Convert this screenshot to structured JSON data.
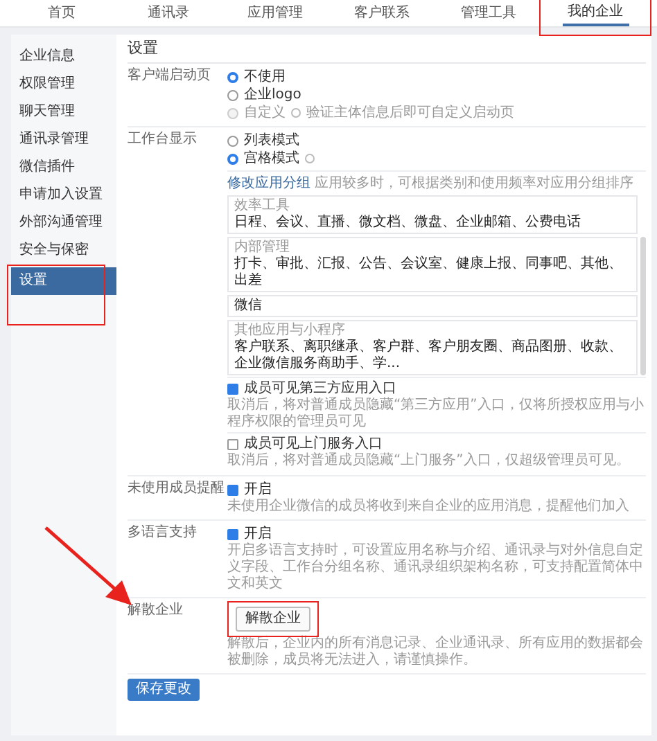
{
  "nav": [
    {
      "label": "首页",
      "selected": false,
      "highlighted": false
    },
    {
      "label": "通讯录",
      "selected": false,
      "highlighted": false
    },
    {
      "label": "应用管理",
      "selected": false,
      "highlighted": false
    },
    {
      "label": "客户联系",
      "selected": false,
      "highlighted": false
    },
    {
      "label": "管理工具",
      "selected": false,
      "highlighted": false
    },
    {
      "label": "我的企业",
      "selected": true,
      "highlighted": true
    }
  ],
  "sidebar": {
    "items": [
      {
        "label": "企业信息",
        "selected": false,
        "highlighted": false
      },
      {
        "label": "权限管理",
        "selected": false,
        "highlighted": false
      },
      {
        "label": "聊天管理",
        "selected": false,
        "highlighted": false
      },
      {
        "label": "通讯录管理",
        "selected": false,
        "highlighted": false
      },
      {
        "label": "微信插件",
        "selected": false,
        "highlighted": false
      },
      {
        "label": "申请加入设置",
        "selected": false,
        "highlighted": false
      },
      {
        "label": "外部沟通管理",
        "selected": false,
        "highlighted": false
      },
      {
        "label": "安全与保密",
        "selected": false,
        "highlighted": false
      },
      {
        "label": "设置",
        "selected": true,
        "highlighted": true
      }
    ]
  },
  "page_title": "设置",
  "sections": [
    {
      "kind": "radios",
      "label": "客户端启动页",
      "options": [
        {
          "label": "不使用",
          "selected": true,
          "disabled": false
        },
        {
          "label": "企业logo",
          "selected": false,
          "disabled": false
        },
        {
          "label": "自定义",
          "selected": false,
          "disabled": true,
          "hint": "验证主体信息后即可自定义启动页"
        }
      ]
    },
    {
      "kind": "workbench",
      "label": "工作台显示",
      "options": [
        {
          "label": "列表模式",
          "selected": false,
          "disabled": false,
          "info": false
        },
        {
          "label": "宫格模式",
          "selected": true,
          "disabled": false,
          "info": true
        }
      ],
      "group_link": "修改应用分组",
      "group_hint": "应用较多时，可根据类别和使用频率对应用分组排序",
      "groups": [
        {
          "title": "效率工具",
          "apps": "日程、会议、直播、微文档、微盘、企业邮箱、公费电话"
        },
        {
          "title": "内部管理",
          "apps": "打卡、审批、汇报、公告、会议室、健康上报、同事吧、其他、出差"
        },
        {
          "apps": "微信"
        },
        {
          "title": "其他应用与小程序",
          "apps": "客户联系、离职继承、客户群、客户朋友圈、商品图册、收款、企业微信服务商助手、学..."
        }
      ],
      "toggles": [
        {
          "label": "成员可见第三方应用入口",
          "checked": true,
          "description": "取消后，将对普通成员隐藏“第三方应用”入口，仅将所授权应用与小程序权限的管理员可见"
        },
        {
          "label": "成员可见上门服务入口",
          "checked": false,
          "description": "取消后，将对普通成员隐藏“上门服务”入口，仅超级管理员可见。"
        }
      ]
    },
    {
      "kind": "checkbox",
      "label": "未使用成员提醒",
      "checkbox": {
        "label": "开启",
        "checked": true
      },
      "description": "未使用企业微信的成员将收到来自企业的应用消息，提醒他们加入"
    },
    {
      "kind": "checkbox",
      "label": "多语言支持",
      "checkbox": {
        "label": "开启",
        "checked": true
      },
      "description": "开启多语言支持时，可设置应用名称与介绍、通讯录与对外信息自定义字段、工作台分组名称、通讯录组织架构名称，可支持配置简体中文和英文"
    },
    {
      "kind": "action",
      "label": "解散企业",
      "button": {
        "label": "解散企业",
        "highlighted": true
      },
      "arrow": true,
      "description": "解散后，企业内的所有消息记录、企业通讯录、所有应用的数据都会被删除，成员将无法进入，请谨慎操作。"
    }
  ],
  "save_button": "保存更改"
}
